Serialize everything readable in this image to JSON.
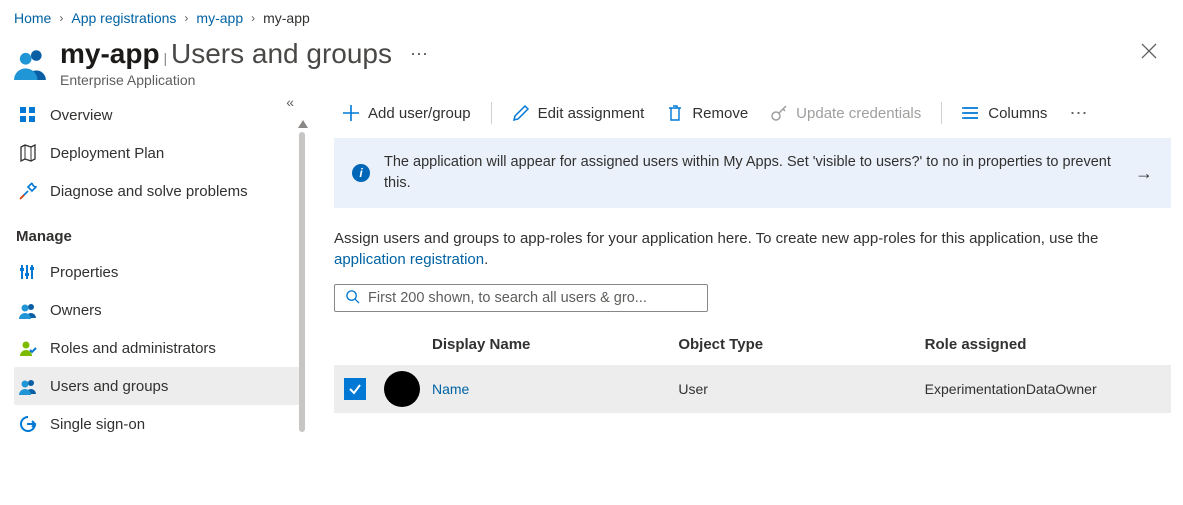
{
  "breadcrumb": {
    "items": [
      "Home",
      "App registrations",
      "my-app",
      "my-app"
    ]
  },
  "header": {
    "app_name": "my-app",
    "page_title": "Users and groups",
    "subtitle": "Enterprise Application"
  },
  "sidebar": {
    "items": [
      {
        "icon": "grid",
        "label": "Overview"
      },
      {
        "icon": "map",
        "label": "Deployment Plan"
      },
      {
        "icon": "wrench",
        "label": "Diagnose and solve problems"
      }
    ],
    "manage_label": "Manage",
    "manage_items": [
      {
        "icon": "props",
        "label": "Properties"
      },
      {
        "icon": "owners",
        "label": "Owners"
      },
      {
        "icon": "roles",
        "label": "Roles and administrators"
      },
      {
        "icon": "users",
        "label": "Users and groups",
        "active": true
      },
      {
        "icon": "sso",
        "label": "Single sign-on"
      }
    ]
  },
  "toolbar": {
    "add": "Add user/group",
    "edit": "Edit assignment",
    "remove": "Remove",
    "update": "Update credentials",
    "columns": "Columns"
  },
  "banner": {
    "text": "The application will appear for assigned users within My Apps. Set 'visible to users?' to no in properties to prevent this."
  },
  "description": {
    "text": "Assign users and groups to app-roles for your application here. To create new app-roles for this application, use the ",
    "link": "application registration",
    "suffix": "."
  },
  "search": {
    "placeholder": "First 200 shown, to search all users & gro..."
  },
  "table": {
    "headers": [
      "Display Name",
      "Object Type",
      "Role assigned"
    ],
    "rows": [
      {
        "name": "Name",
        "type": "User",
        "role": "ExperimentationDataOwner",
        "checked": true
      }
    ]
  }
}
